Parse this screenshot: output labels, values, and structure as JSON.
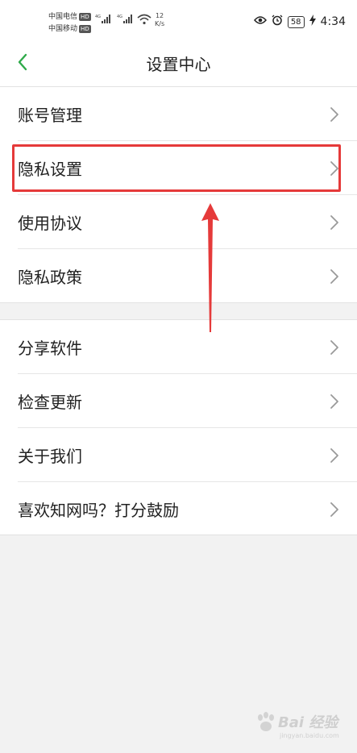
{
  "status_bar": {
    "carrier1": "中国电信",
    "carrier2": "中国移动",
    "hd": "HD",
    "signal_tag": "4G",
    "speed_value": "12",
    "speed_unit": "K/s",
    "battery": "58",
    "time": "4:34"
  },
  "header": {
    "title": "设置中心"
  },
  "groups": [
    {
      "items": [
        {
          "label": "账号管理"
        },
        {
          "label": "隐私设置"
        },
        {
          "label": "使用协议"
        },
        {
          "label": "隐私政策"
        }
      ]
    },
    {
      "items": [
        {
          "label": "分享软件"
        },
        {
          "label": "检查更新"
        },
        {
          "label": "关于我们"
        },
        {
          "label": "喜欢知网吗？打分鼓励"
        }
      ]
    }
  ],
  "annotation": {
    "highlight_color": "#e53a3a",
    "highlighted_item": "隐私设置"
  },
  "watermark": {
    "brand": "Bai 经验",
    "url": "jingyan.baidu.com"
  },
  "colors": {
    "back_arrow": "#2faa4a",
    "background": "#f2f2f2"
  }
}
